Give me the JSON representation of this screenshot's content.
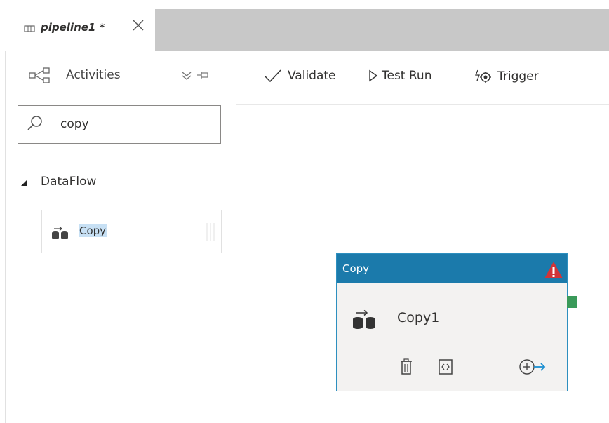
{
  "tab": {
    "title": "pipeline1 *",
    "icon": "pipeline-icon",
    "close_icon": "close-icon"
  },
  "sidebar": {
    "header_label": "Activities",
    "search": {
      "value": "copy",
      "placeholder": ""
    },
    "category": {
      "label": "DataFlow",
      "expanded": true
    },
    "items": [
      {
        "label": "Copy",
        "icon": "copy-data-icon"
      }
    ]
  },
  "toolbar": {
    "validate_label": "Validate",
    "test_run_label": "Test Run",
    "trigger_label": "Trigger"
  },
  "canvas": {
    "activity": {
      "type_label": "Copy",
      "name": "Copy1",
      "status": "warning"
    }
  },
  "colors": {
    "activity_header": "#1b7aab",
    "warning": "#d13438",
    "output_port": "#3a9a5a",
    "highlight": "#c7e0f4"
  }
}
